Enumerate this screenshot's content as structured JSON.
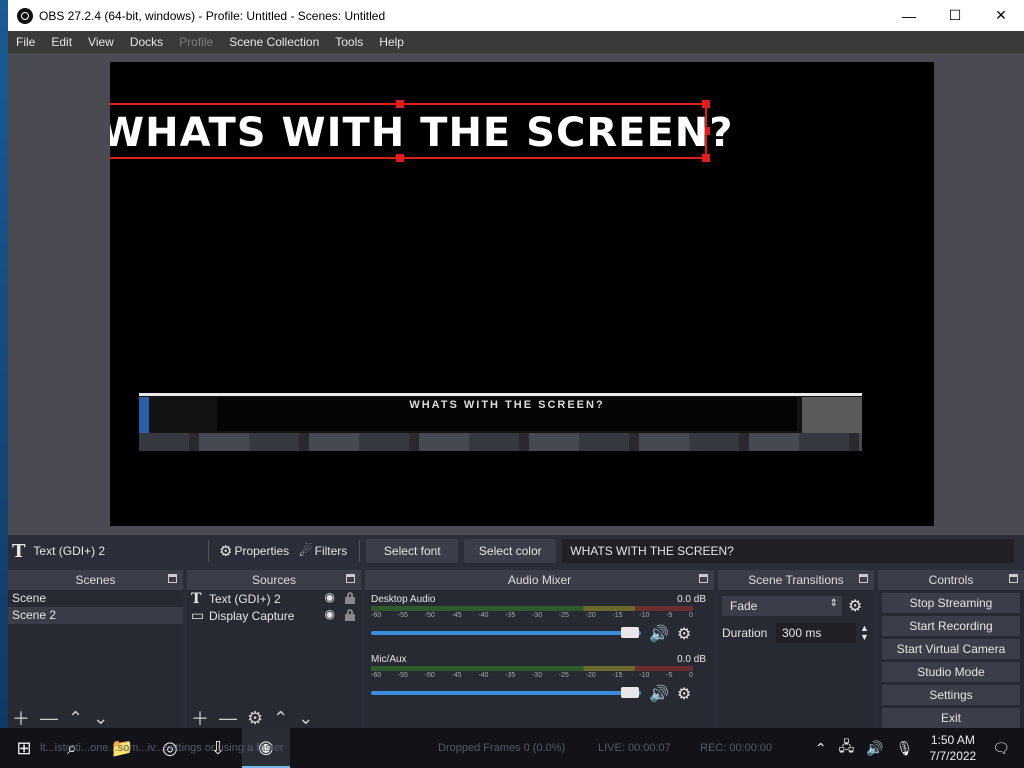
{
  "window": {
    "title": "OBS 27.2.4 (64-bit, windows) - Profile: Untitled - Scenes: Untitled",
    "controls": {
      "minimize": "—",
      "maximize": "☐",
      "close": "✕"
    }
  },
  "menu": {
    "items": [
      {
        "label": "File"
      },
      {
        "label": "Edit"
      },
      {
        "label": "View"
      },
      {
        "label": "Docks"
      },
      {
        "label": "Profile",
        "disabled": true
      },
      {
        "label": "Scene Collection"
      },
      {
        "label": "Tools"
      },
      {
        "label": "Help"
      }
    ]
  },
  "preview": {
    "overlay_text": "WHATS WITH THE SCREEN?",
    "capture_text": "WHATS WITH THE SCREEN?"
  },
  "context": {
    "source_name": "Text (GDI+) 2",
    "properties_label": "Properties",
    "filters_label": "Filters",
    "select_font": "Select font",
    "select_color": "Select color",
    "text_value": "WHATS WITH THE SCREEN?"
  },
  "scenes": {
    "header": "Scenes",
    "items": [
      "Scene",
      "Scene 2"
    ],
    "selected_index": 1
  },
  "sources": {
    "header": "Sources",
    "items": [
      {
        "label": "Text (GDI+) 2",
        "icon": "text-icon"
      },
      {
        "label": "Display Capture",
        "icon": "monitor-icon"
      }
    ]
  },
  "mixer": {
    "header": "Audio Mixer",
    "ticks": [
      "-60",
      "-55",
      "-50",
      "-45",
      "-40",
      "-35",
      "-30",
      "-25",
      "-20",
      "-15",
      "-10",
      "-5",
      "0"
    ],
    "channels": [
      {
        "name": "Desktop Audio",
        "db": "0.0 dB"
      },
      {
        "name": "Mic/Aux",
        "db": "0.0 dB"
      }
    ]
  },
  "transitions": {
    "header": "Scene Transitions",
    "selected": "Fade",
    "duration_label": "Duration",
    "duration_value": "300 ms"
  },
  "controls": {
    "header": "Controls",
    "buttons": [
      "Stop Streaming",
      "Start Recording",
      "Start Virtual Camera",
      "Studio Mode",
      "Settings",
      "Exit"
    ]
  },
  "taskbar": {
    "status_left": "lt...istrati...one...som...iv...settings or using a faster",
    "dropped_frames": "Dropped Frames 0 (0.0%)",
    "live": "LIVE: 00:00:07",
    "rec": "REC: 00:00:00",
    "time": "1:50 AM",
    "date": "7/7/2022"
  },
  "colors": {
    "selection": "#e01d1d",
    "slider": "#3b8de0",
    "panel": "#272a33"
  }
}
